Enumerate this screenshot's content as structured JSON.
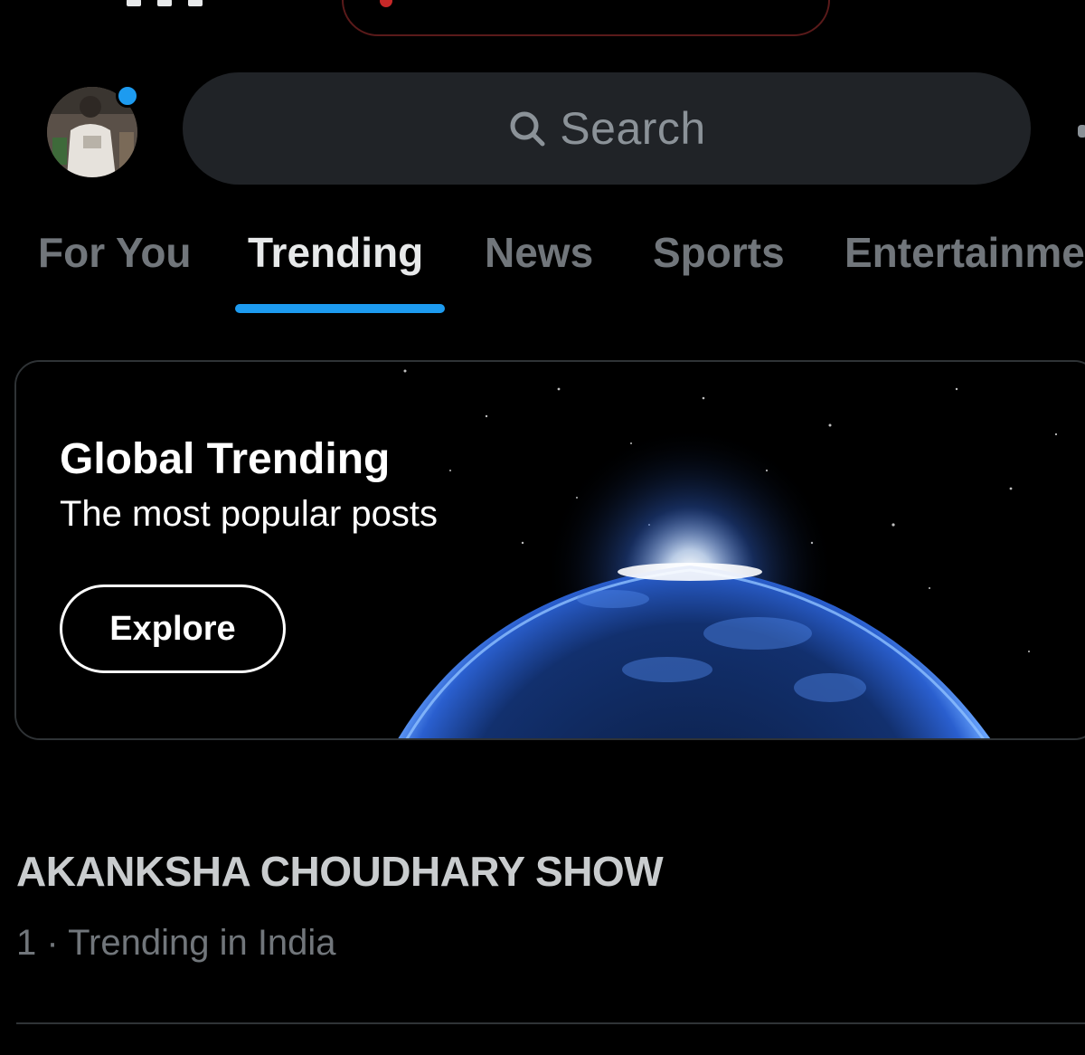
{
  "header": {
    "search_placeholder": "Search",
    "accent_color": "#1d9bf0"
  },
  "tabs": [
    {
      "label": "For You",
      "active": false
    },
    {
      "label": "Trending",
      "active": true
    },
    {
      "label": "News",
      "active": false
    },
    {
      "label": "Sports",
      "active": false
    },
    {
      "label": "Entertainme",
      "active": false
    }
  ],
  "banner": {
    "title": "Global Trending",
    "subtitle": "The most popular posts",
    "button_label": "Explore"
  },
  "trends": [
    {
      "name": "AKANKSHA CHOUDHARY SHOW",
      "meta": "1 · Trending in India"
    }
  ]
}
